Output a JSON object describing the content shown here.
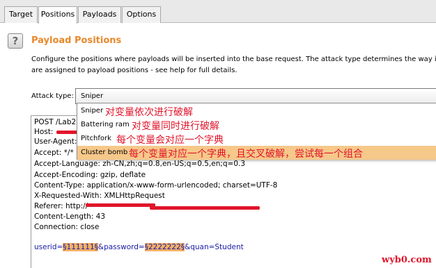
{
  "tabs": [
    {
      "label": "Target"
    },
    {
      "label": "Positions",
      "active": true
    },
    {
      "label": "Payloads"
    },
    {
      "label": "Options"
    }
  ],
  "help_icon": "?",
  "section": {
    "title": "Payload Positions",
    "description_line1": "Configure the positions where payloads will be inserted into the base request. The attack type determines the way in wh",
    "description_line2": "are assigned to payload positions - see help for full details."
  },
  "attack_type": {
    "label": "Attack type:",
    "selected": "Sniper",
    "options": [
      {
        "name": "Sniper",
        "note": "对变量依次进行破解"
      },
      {
        "name": "Battering ram",
        "note": "对变量同时进行破解"
      },
      {
        "name": "Pitchfork",
        "note": "每个变量会对应一个字典"
      },
      {
        "name": "Cluster bomb",
        "note": "每个变量对应一个字典，且交叉破解，尝试每一个组合",
        "highlighted": true
      }
    ]
  },
  "request": {
    "lines": [
      "POST /Lab2",
      "Host: ",
      "User-Agent: ",
      "Accept: */*",
      "Accept-Language: zh-CN,zh;q=0.8,en-US;q=0.5,en;q=0.3",
      "Accept-Encoding: gzip, deflate",
      "Content-Type: application/x-www-form-urlencoded; charset=UTF-8",
      "X-Requested-With: XMLHttpRequest",
      "Referer: http://",
      "Content-Length: 43",
      "Connection: close"
    ],
    "body": {
      "prefix": "userid=",
      "marker1": "§111111§",
      "mid": "&password=",
      "marker2": "§2222222§",
      "suffix": "&quan=Student"
    }
  },
  "watermark": "wyb0.com",
  "colors": {
    "accent": "#e8882a",
    "annotation": "#e0152b",
    "highlight": "#f6c88a",
    "payload_marker": "#f3b066"
  }
}
